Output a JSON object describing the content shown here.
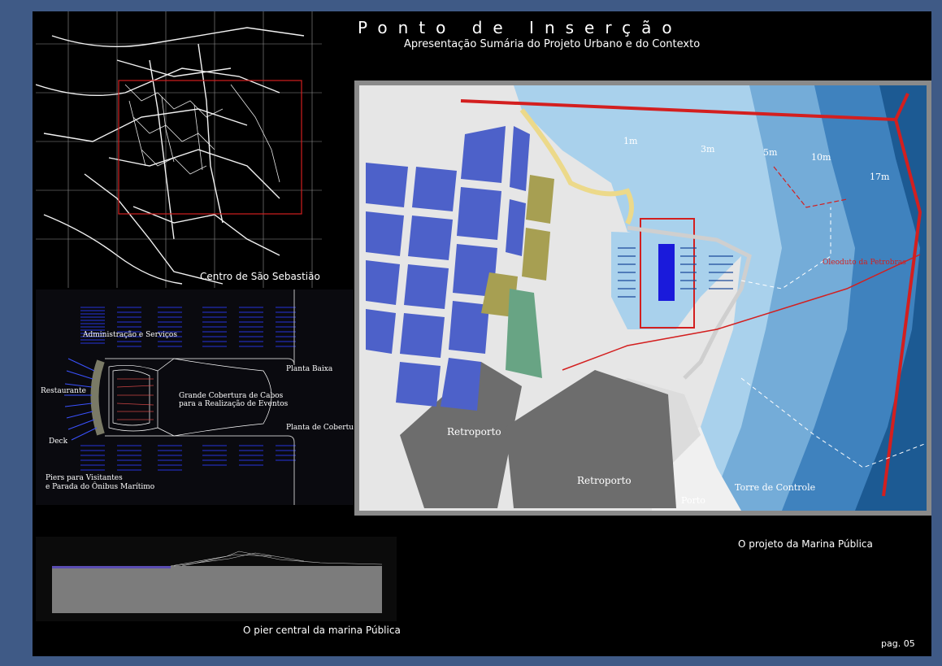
{
  "header": {
    "title": "Ponto de Inserção",
    "subtitle": "Apresentação Sumária do Projeto Urbano e do Contexto"
  },
  "city_map": {
    "caption": "Centro de São Sebastião"
  },
  "marina_plan": {
    "labels": {
      "admin": "Administração e Serviços",
      "restaurant": "Restaurante",
      "deck": "Deck",
      "plan_low": "Planta  Baixa",
      "cover_line1": "Grande Cobertura de Cabos",
      "cover_line2": "para a  Realização de Eventos",
      "plan_cover": "Planta  de Cobertura",
      "piers_line1": "Piers para Visitantes",
      "piers_line2": "e Parada do Ônibus Marítimo"
    }
  },
  "pier_section": {
    "caption": "O pier central da marina Pública"
  },
  "main_map": {
    "caption": "O projeto da Marina Pública",
    "depths": [
      "1m",
      "3m",
      "5m",
      "10m",
      "17m"
    ],
    "retroporto": "Retroporto",
    "porto": "Porto",
    "torre": "Torre de Controle",
    "oleoduto": "Oleoduto da Petrobras"
  },
  "footer": {
    "page": "pag. 05"
  },
  "colors": {
    "background": "#3f5a86",
    "page": "#000000",
    "highlight_red": "#d31f1f",
    "blocks_blue": "#4d61c9",
    "sea_light": "#a8d0ea",
    "sea_dark": "#1f5f95"
  }
}
